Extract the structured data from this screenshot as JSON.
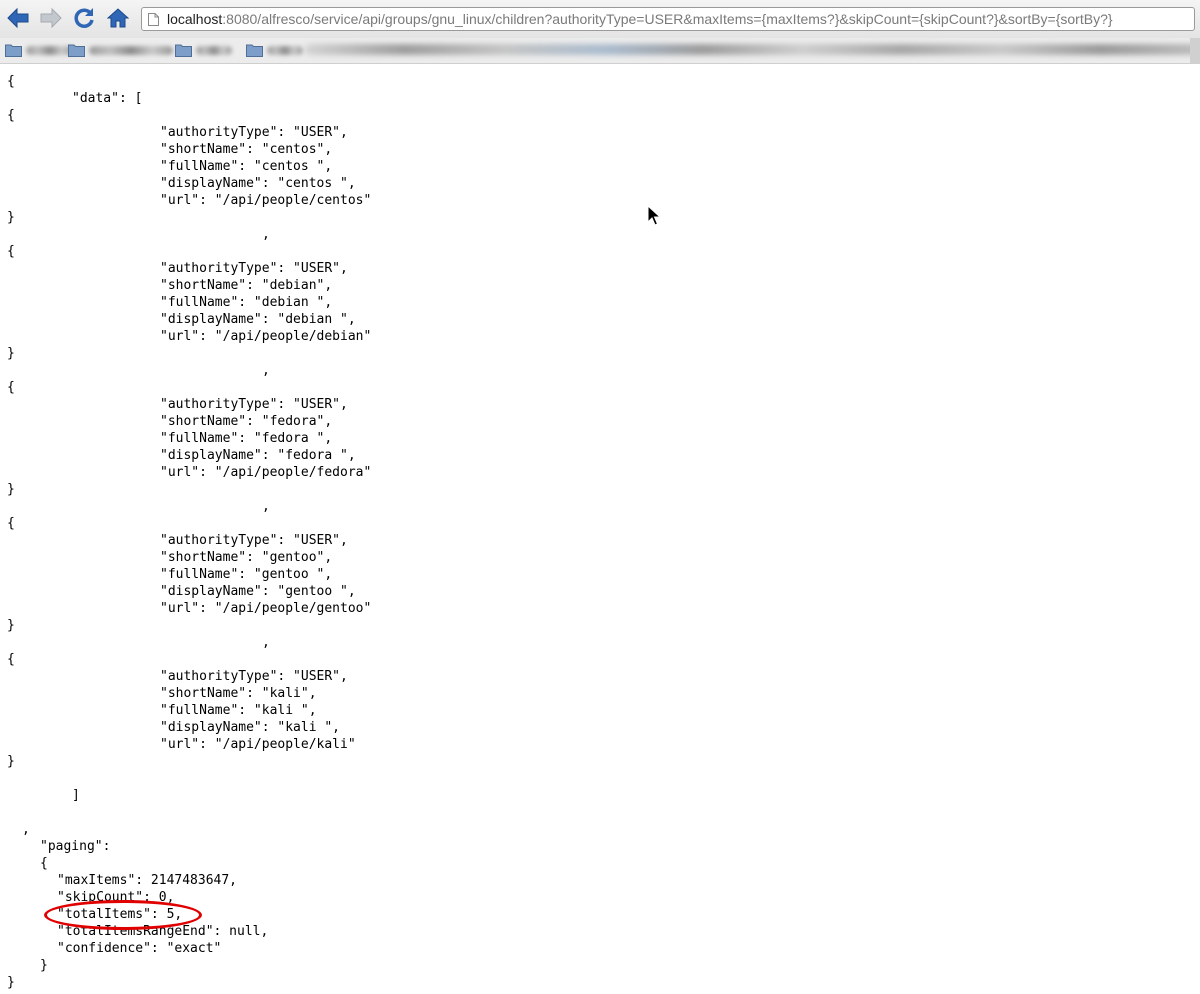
{
  "browser": {
    "url_host": "localhost",
    "url_rest": ":8080/alfresco/service/api/groups/gnu_linux/children?authorityType=USER&maxItems={maxItems?}&skipCount={skipCount?}&sortBy={sortBy?}",
    "icons": [
      "back-arrow-icon",
      "forward-arrow-icon",
      "reload-icon",
      "home-icon",
      "page-icon",
      "folder-icon"
    ]
  },
  "json_lines": {
    "open": "{",
    "data_key": "\"data\": [",
    "close_array": "]",
    "comma": ",",
    "paging_key": "\"paging\":",
    "paging_open": "{",
    "paging_close": "}",
    "close": "}"
  },
  "users": [
    {
      "authorityType": "\"authorityType\": \"USER\",",
      "shortName": "\"shortName\": \"centos\",",
      "fullName": "\"fullName\": \"centos \",",
      "displayName": "\"displayName\": \"centos \",",
      "url": "\"url\": \"/api/people/centos\""
    },
    {
      "authorityType": "\"authorityType\": \"USER\",",
      "shortName": "\"shortName\": \"debian\",",
      "fullName": "\"fullName\": \"debian \",",
      "displayName": "\"displayName\": \"debian \",",
      "url": "\"url\": \"/api/people/debian\""
    },
    {
      "authorityType": "\"authorityType\": \"USER\",",
      "shortName": "\"shortName\": \"fedora\",",
      "fullName": "\"fullName\": \"fedora \",",
      "displayName": "\"displayName\": \"fedora \",",
      "url": "\"url\": \"/api/people/fedora\""
    },
    {
      "authorityType": "\"authorityType\": \"USER\",",
      "shortName": "\"shortName\": \"gentoo\",",
      "fullName": "\"fullName\": \"gentoo \",",
      "displayName": "\"displayName\": \"gentoo \",",
      "url": "\"url\": \"/api/people/gentoo\""
    },
    {
      "authorityType": "\"authorityType\": \"USER\",",
      "shortName": "\"shortName\": \"kali\",",
      "fullName": "\"fullName\": \"kali \",",
      "displayName": "\"displayName\": \"kali \",",
      "url": "\"url\": \"/api/people/kali\""
    }
  ],
  "paging": {
    "maxItems": "\"maxItems\": 2147483647,",
    "skipCount": "\"skipCount\": 0,",
    "totalItems": "\"totalItems\": 5,",
    "totalItemsRangeEnd": "\"totalItemsRangeEnd\": null,",
    "confidence": "\"confidence\": \"exact\""
  },
  "colors": {
    "highlight": "#e00000",
    "text": "#000000",
    "background": "#ffffff"
  }
}
